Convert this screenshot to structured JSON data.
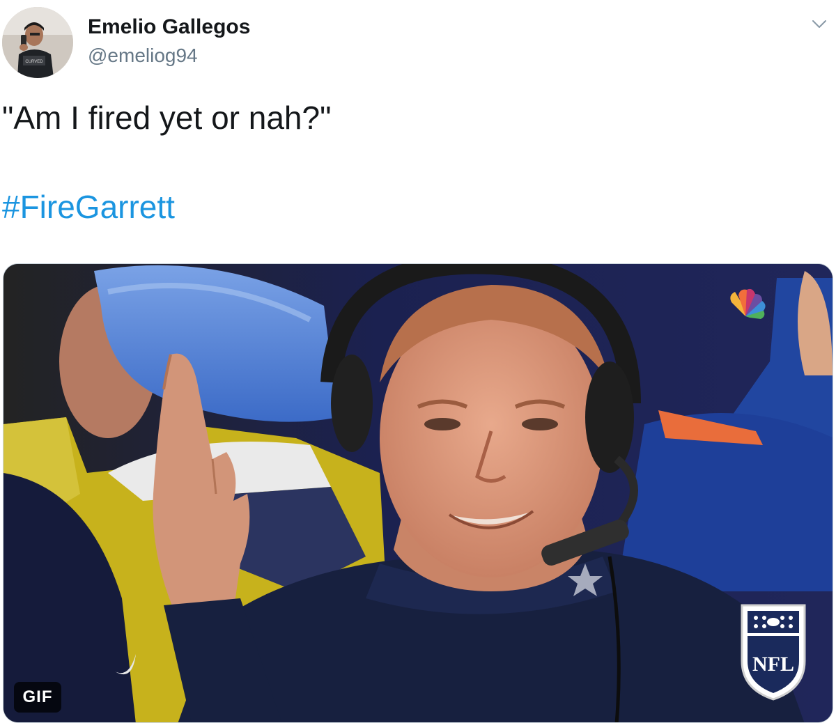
{
  "tweet": {
    "author": {
      "display_name": "Emelio Gallegos",
      "handle": "@emeliog94"
    },
    "text": "\"Am I fired yet or nah?\"",
    "hashtag": "#FireGarrett",
    "media": {
      "badge": "GIF",
      "overlay_logo": "NFL"
    }
  },
  "colors": {
    "text_primary": "#14171a",
    "text_secondary": "#657786",
    "link": "#1b95e0",
    "media_border": "#ccd6dd"
  },
  "icons": {
    "caret": "chevron-down-icon",
    "network_logo": "peacock-icon",
    "league_logo": "nfl-shield-icon"
  }
}
